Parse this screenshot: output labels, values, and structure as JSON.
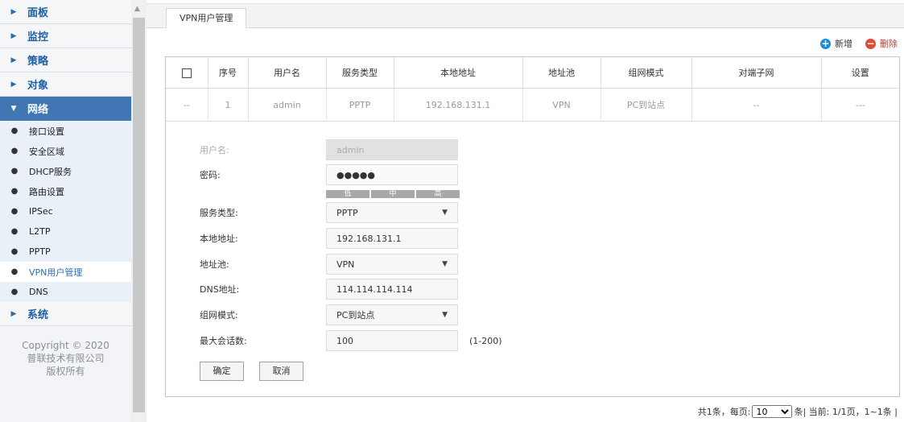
{
  "sidebar": {
    "top_items": [
      {
        "label": "面板"
      },
      {
        "label": "监控"
      },
      {
        "label": "策略"
      },
      {
        "label": "对象"
      }
    ],
    "active_item": {
      "label": "网络"
    },
    "sub_items": [
      {
        "label": "接口设置"
      },
      {
        "label": "安全区域"
      },
      {
        "label": "DHCP服务"
      },
      {
        "label": "路由设置"
      },
      {
        "label": "IPSec"
      },
      {
        "label": "L2TP"
      },
      {
        "label": "PPTP"
      },
      {
        "label": "VPN用户管理"
      },
      {
        "label": "DNS"
      }
    ],
    "bottom_item": {
      "label": "系统"
    },
    "copyright": [
      "Copyright © 2020",
      "普联技术有限公司",
      "版权所有"
    ]
  },
  "tab": {
    "label": "VPN用户管理"
  },
  "actions": {
    "add": "新增",
    "delete": "删除"
  },
  "table": {
    "headers": [
      "序号",
      "用户名",
      "服务类型",
      "本地地址",
      "地址池",
      "组网模式",
      "对端子网",
      "设置"
    ],
    "row": [
      "--",
      "1",
      "admin",
      "PPTP",
      "192.168.131.1",
      "VPN",
      "PC到站点",
      "--",
      "---"
    ]
  },
  "form": {
    "username_label": "用户名:",
    "username_value": "admin",
    "password_label": "密码:",
    "password_value": "●●●●●",
    "strength": [
      "低",
      "中",
      "高"
    ],
    "service_label": "服务类型:",
    "service_value": "PPTP",
    "local_label": "本地地址:",
    "local_value": "192.168.131.1",
    "pool_label": "地址池:",
    "pool_value": "VPN",
    "dns_label": "DNS地址:",
    "dns_value": "114.114.114.114",
    "mode_label": "组网模式:",
    "mode_value": "PC到站点",
    "max_label": "最大会话数:",
    "max_value": "100",
    "max_hint": "(1-200)",
    "ok": "确定",
    "cancel": "取消"
  },
  "pager": {
    "total": "共1条，每页:",
    "per_page": "10",
    "unit": "条",
    "current": "| 当前: 1/1页，1~1条 |"
  }
}
